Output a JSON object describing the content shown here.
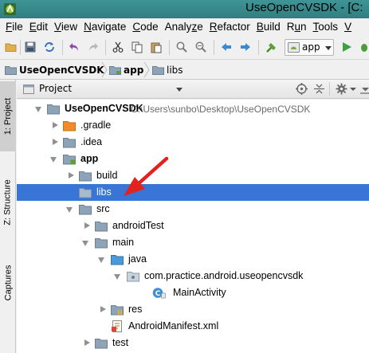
{
  "window": {
    "title": "UseOpenCVSDK - [C:"
  },
  "menu": {
    "items": [
      {
        "pre": "",
        "u": "F",
        "post": "ile"
      },
      {
        "pre": "",
        "u": "E",
        "post": "dit"
      },
      {
        "pre": "",
        "u": "V",
        "post": "iew"
      },
      {
        "pre": "",
        "u": "N",
        "post": "avigate"
      },
      {
        "pre": "",
        "u": "C",
        "post": "ode"
      },
      {
        "pre": "Analy",
        "u": "z",
        "post": "e"
      },
      {
        "pre": "",
        "u": "R",
        "post": "efactor"
      },
      {
        "pre": "",
        "u": "B",
        "post": "uild"
      },
      {
        "pre": "R",
        "u": "u",
        "post": "n"
      },
      {
        "pre": "",
        "u": "T",
        "post": "ools"
      },
      {
        "pre": "",
        "u": "V",
        "post": ""
      }
    ]
  },
  "toolbar": {
    "run_config_label": "app"
  },
  "breadcrumb": {
    "items": [
      "UseOpenCVSDK",
      "app",
      "libs"
    ]
  },
  "left_strip": {
    "tab_project": "1: Project",
    "tab_structure": "Z: Structure",
    "tab_captures": "Captures"
  },
  "panel": {
    "title": "Project"
  },
  "tree": {
    "root_label": "UseOpenCVSDK",
    "root_path": "C:\\Users\\sunbo\\Desktop\\UseOpenCVSDK",
    "gradle": ".gradle",
    "idea": ".idea",
    "app": "app",
    "build": "build",
    "libs": "libs",
    "src": "src",
    "android_test": "androidTest",
    "main": "main",
    "java": "java",
    "package": "com.practice.android.useopencvsdk",
    "main_activity": "MainActivity",
    "res": "res",
    "manifest": "AndroidManifest.xml",
    "test": "test"
  },
  "colors": {
    "titlebar": "#3f9496",
    "selection": "#3875d7",
    "folder": "#8fa3b6",
    "annotation_arrow": "#e2221d"
  }
}
